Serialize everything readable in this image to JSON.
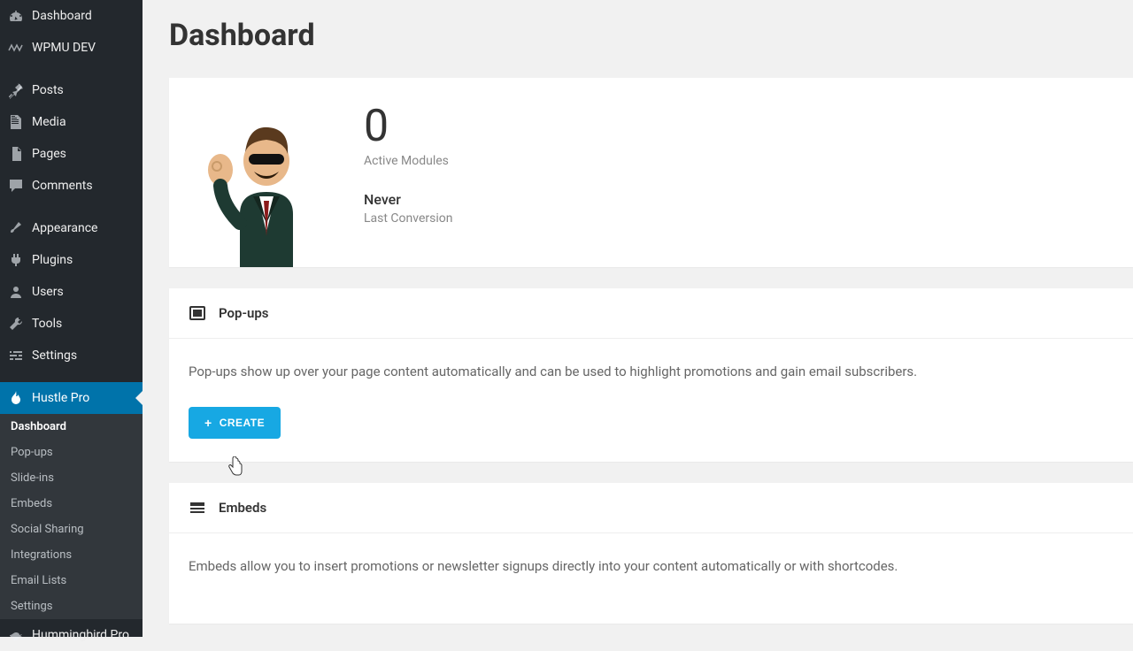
{
  "sidebar": {
    "items": [
      {
        "label": "Dashboard",
        "icon": "dashboard"
      },
      {
        "label": "WPMU DEV",
        "icon": "wpmu"
      },
      {
        "label": "Posts",
        "icon": "pin"
      },
      {
        "label": "Media",
        "icon": "media"
      },
      {
        "label": "Pages",
        "icon": "page"
      },
      {
        "label": "Comments",
        "icon": "comment"
      },
      {
        "label": "Appearance",
        "icon": "brush"
      },
      {
        "label": "Plugins",
        "icon": "plug"
      },
      {
        "label": "Users",
        "icon": "user"
      },
      {
        "label": "Tools",
        "icon": "wrench"
      },
      {
        "label": "Settings",
        "icon": "sliders"
      },
      {
        "label": "Hustle Pro",
        "icon": "flame"
      },
      {
        "label": "Hummingbird Pro",
        "icon": "bird"
      }
    ],
    "sub": [
      {
        "label": "Dashboard"
      },
      {
        "label": "Pop-ups"
      },
      {
        "label": "Slide-ins"
      },
      {
        "label": "Embeds"
      },
      {
        "label": "Social Sharing"
      },
      {
        "label": "Integrations"
      },
      {
        "label": "Email Lists"
      },
      {
        "label": "Settings"
      }
    ]
  },
  "page": {
    "title": "Dashboard"
  },
  "stats": {
    "active_modules_value": "0",
    "active_modules_label": "Active Modules",
    "last_conversion_value": "Never",
    "last_conversion_label": "Last Conversion"
  },
  "popups": {
    "title": "Pop-ups",
    "description": "Pop-ups show up over your page content automatically and can be used to highlight promotions and gain email subscribers.",
    "create_label": "CREATE"
  },
  "embeds": {
    "title": "Embeds",
    "description": "Embeds allow you to insert promotions or newsletter signups directly into your content automatically or with shortcodes."
  }
}
